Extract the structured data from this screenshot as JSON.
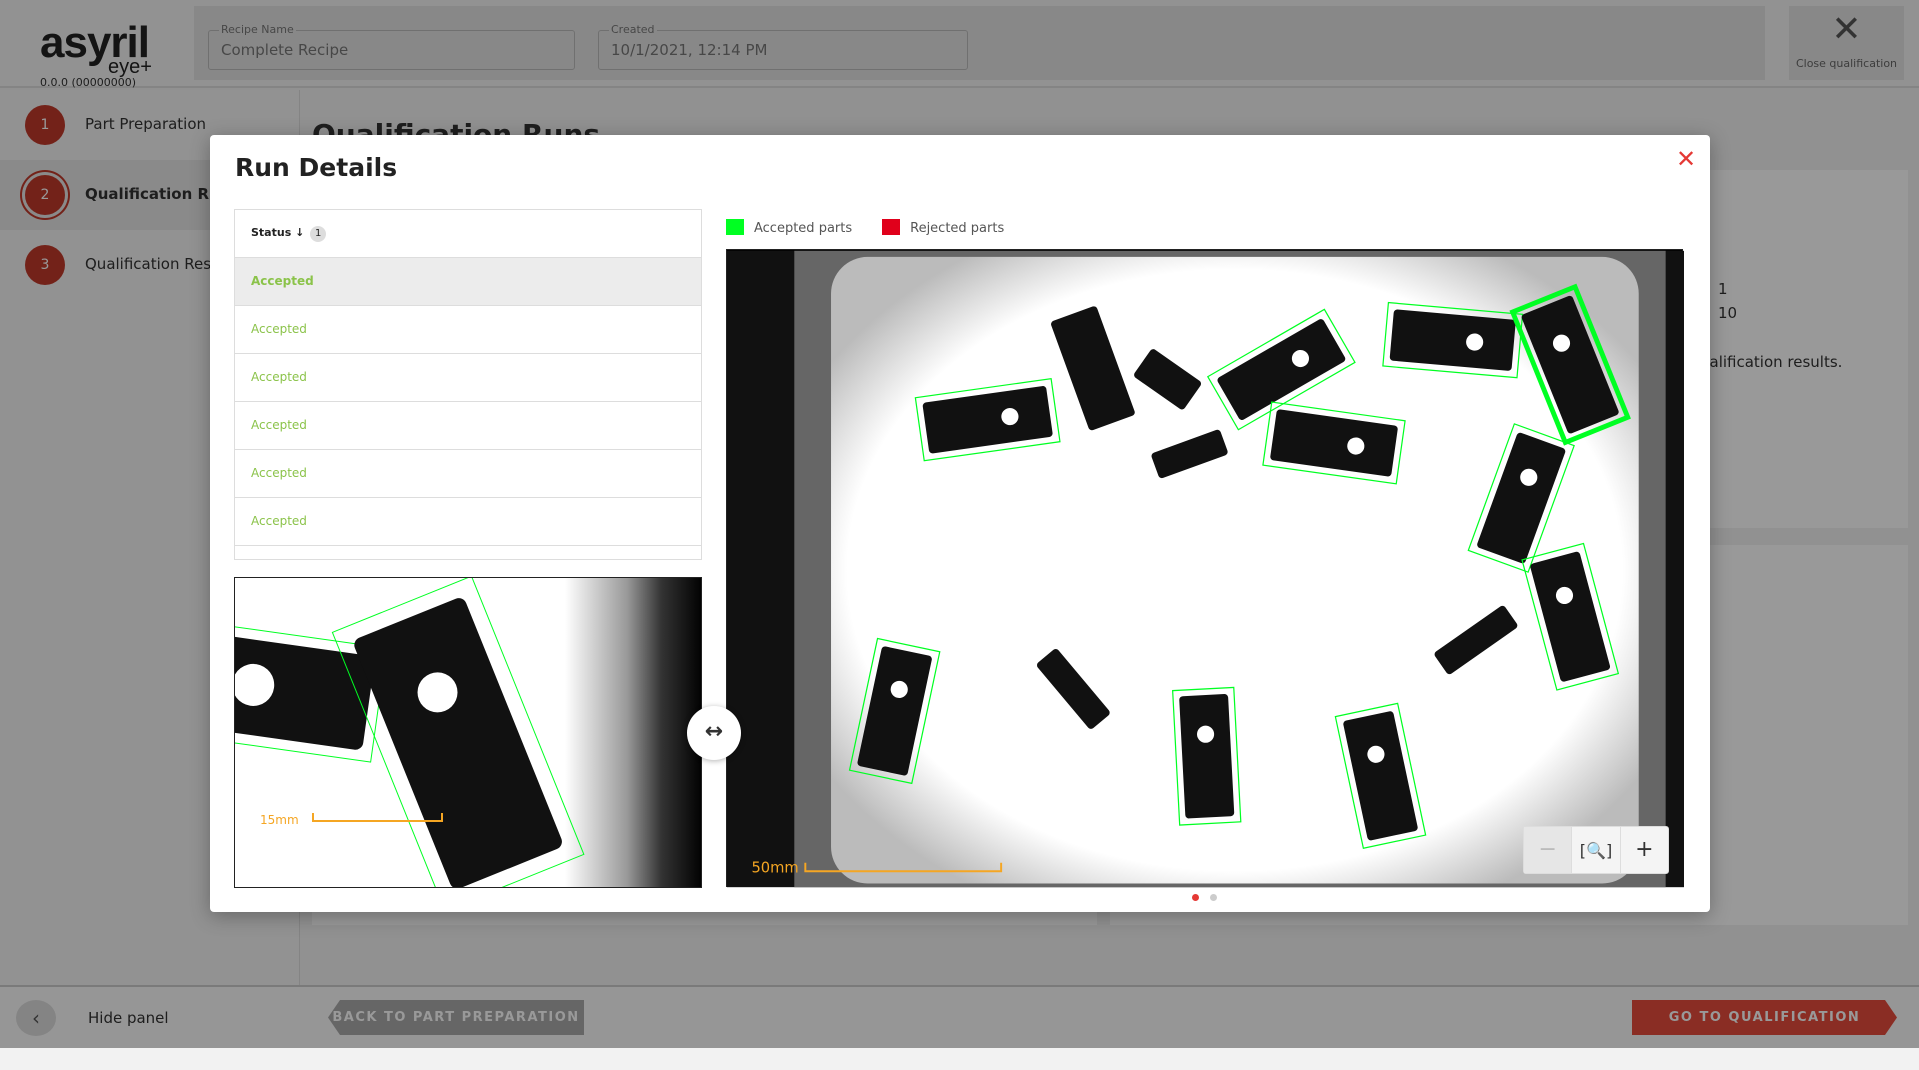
{
  "header": {
    "logo": "asyril",
    "logo_sub": "eye+",
    "version": "0.0.0 (00000000)",
    "recipe_name_label": "Recipe Name",
    "recipe_name_value": "Complete Recipe",
    "created_label": "Created",
    "created_value": "10/1/2021, 12:14 PM",
    "close_label": "Close qualification"
  },
  "sidebar": {
    "steps": [
      {
        "num": "1",
        "label": "Part Preparation"
      },
      {
        "num": "2",
        "label": "Qualification Runs"
      },
      {
        "num": "3",
        "label": "Qualification Results"
      }
    ],
    "hide_label": "Hide panel"
  },
  "main": {
    "title": "Qualification Runs",
    "stat1": "1",
    "stat2": "10",
    "note": "ualification results."
  },
  "footer": {
    "back_label": "BACK TO PART PREPARATION",
    "go_label": "GO TO QUALIFICATION RESULTS"
  },
  "modal": {
    "title": "Run Details",
    "table": {
      "header": "Status",
      "sort_order": "1",
      "rows": [
        "Accepted",
        "Accepted",
        "Accepted",
        "Accepted",
        "Accepted",
        "Accepted"
      ]
    },
    "legend": [
      {
        "label": "Accepted parts",
        "color": "#00ff22"
      },
      {
        "label": "Rejected parts",
        "color": "#e0001b"
      }
    ],
    "thumb_scale": "15mm",
    "main_scale": "50mm",
    "pager": {
      "pages": 2,
      "current": 1
    },
    "accent": "#e53935"
  }
}
